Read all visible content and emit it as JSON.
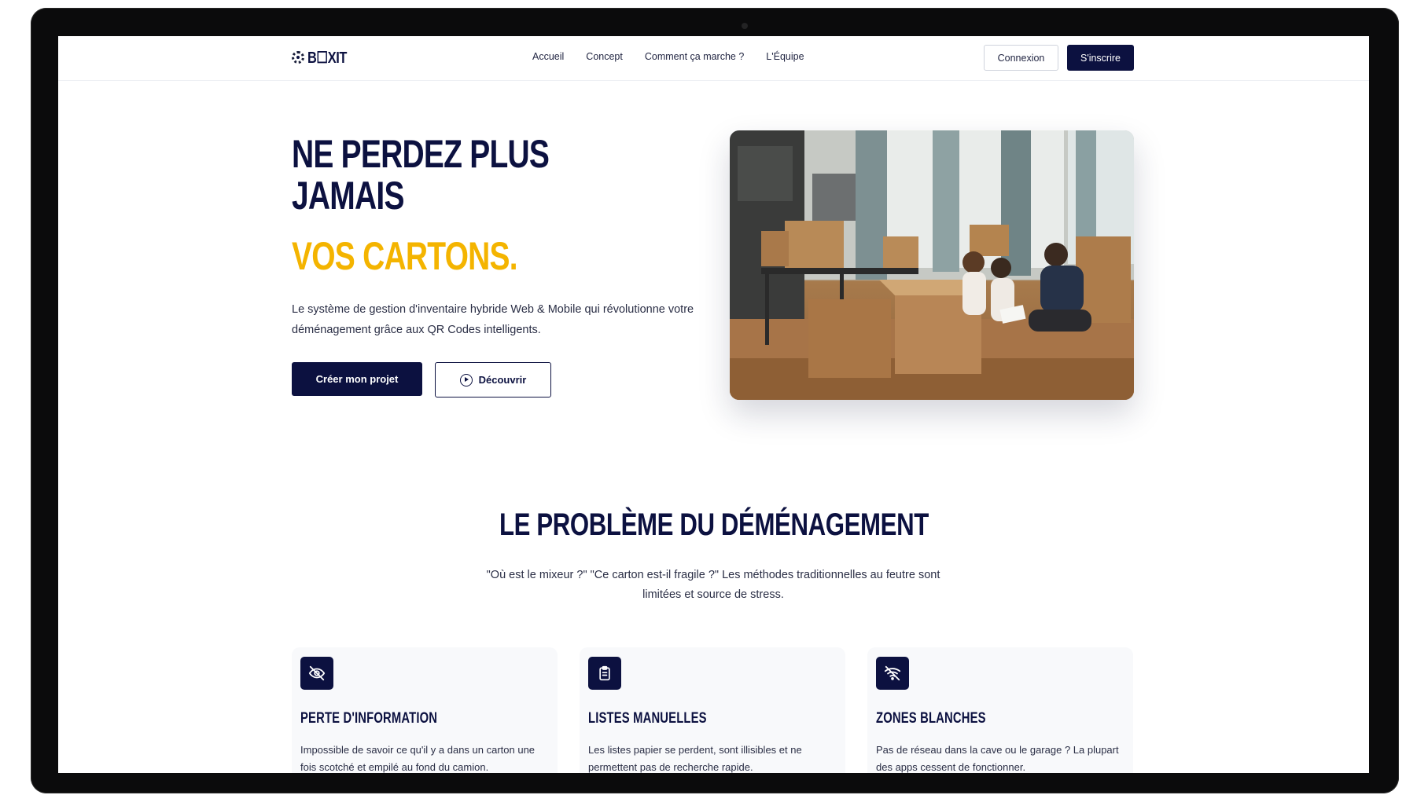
{
  "nav": {
    "logo_text": "B☐XIT",
    "links": [
      "Accueil",
      "Concept",
      "Comment ça marche ?",
      "L'Équipe"
    ],
    "login_label": "Connexion",
    "signup_label": "S'inscrire"
  },
  "hero": {
    "title_line1": "NE PERDEZ PLUS",
    "title_line2": "JAMAIS",
    "title_accent": "VOS CARTONS.",
    "description": "Le système de gestion d'inventaire hybride Web & Mobile qui révolutionne votre déménagement grâce aux QR Codes intelligents.",
    "primary_button": "Créer mon projet",
    "secondary_button": "Découvrir",
    "secondary_icon": "play-circle-icon"
  },
  "problem": {
    "title": "LE PROBLÈME DU DÉMÉNAGEMENT",
    "description": "\"Où est le mixeur ?\" \"Ce carton est-il fragile ?\" Les méthodes traditionnelles au feutre sont limitées et source de stress.",
    "cards": [
      {
        "icon": "eye-off-icon",
        "title": "PERTE D'INFORMATION",
        "text": "Impossible de savoir ce qu'il y a dans un carton une fois scotché et empilé au fond du camion."
      },
      {
        "icon": "clipboard-icon",
        "title": "LISTES MANUELLES",
        "text": "Les listes papier se perdent, sont illisibles et ne permettent pas de recherche rapide."
      },
      {
        "icon": "wifi-off-icon",
        "title": "ZONES BLANCHES",
        "text": "Pas de réseau dans la cave ou le garage ? La plupart des apps cessent de fonctionner."
      }
    ]
  },
  "colors": {
    "navy": "#0c1140",
    "accent": "#f4b400",
    "card_bg": "#f8f9fb"
  }
}
